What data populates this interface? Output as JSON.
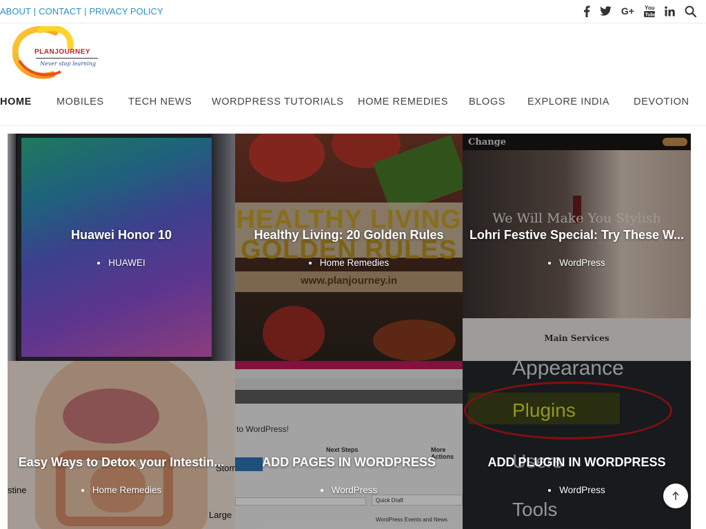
{
  "top_links": [
    "ABOUT",
    "CONTACT",
    "PRIVACY POLICY"
  ],
  "separator": "|",
  "social_icons": [
    "facebook-icon",
    "twitter-icon",
    "google-plus-icon",
    "youtube-icon",
    "linkedin-icon",
    "search-icon"
  ],
  "logo": {
    "name": "PLANJOURNEY",
    "tagline": "Never stop learning"
  },
  "nav": [
    {
      "label": "HOME",
      "active": true
    },
    {
      "label": "MOBILES"
    },
    {
      "label": "TECH NEWS"
    },
    {
      "label": "WORDPRESS TUTORIALS"
    },
    {
      "label": "HOME REMEDIES"
    },
    {
      "label": "BLOGS"
    },
    {
      "label": "EXPLORE INDIA"
    },
    {
      "label": "DEVOTION"
    }
  ],
  "posts": [
    {
      "title": "Huawei Honor 10",
      "category": "HUAWEI"
    },
    {
      "title": "Healthy Living: 20 Golden Rules",
      "category": "Home Remedies",
      "image_text": [
        "HEALTHY LIVING",
        "GOLDEN RULES",
        "www.planjourney.in"
      ]
    },
    {
      "title": "Lohri Festive Special: Try These W...",
      "category": "WordPress",
      "image_text": [
        "Change",
        "We Will Make You Stylish",
        "Main Services"
      ]
    },
    {
      "title": "Easy Ways to Detox your Intestin...",
      "category": "Home Remedies",
      "image_text": [
        "stine",
        "Stom",
        "Large"
      ]
    },
    {
      "title": "ADD PAGES IN WORDPRESS",
      "category": "WordPress",
      "image_text": [
        "to WordPress!",
        "Next Steps",
        "More Actions",
        "Quick Draft",
        "WordPress Events and News"
      ]
    },
    {
      "title": "ADD PLUGIN IN WORDPRESS",
      "category": "WordPress",
      "image_text": [
        "Appearance",
        "Plugins",
        "Users",
        "Tools"
      ]
    }
  ],
  "scroll_top_icon": "arrow-up-icon"
}
